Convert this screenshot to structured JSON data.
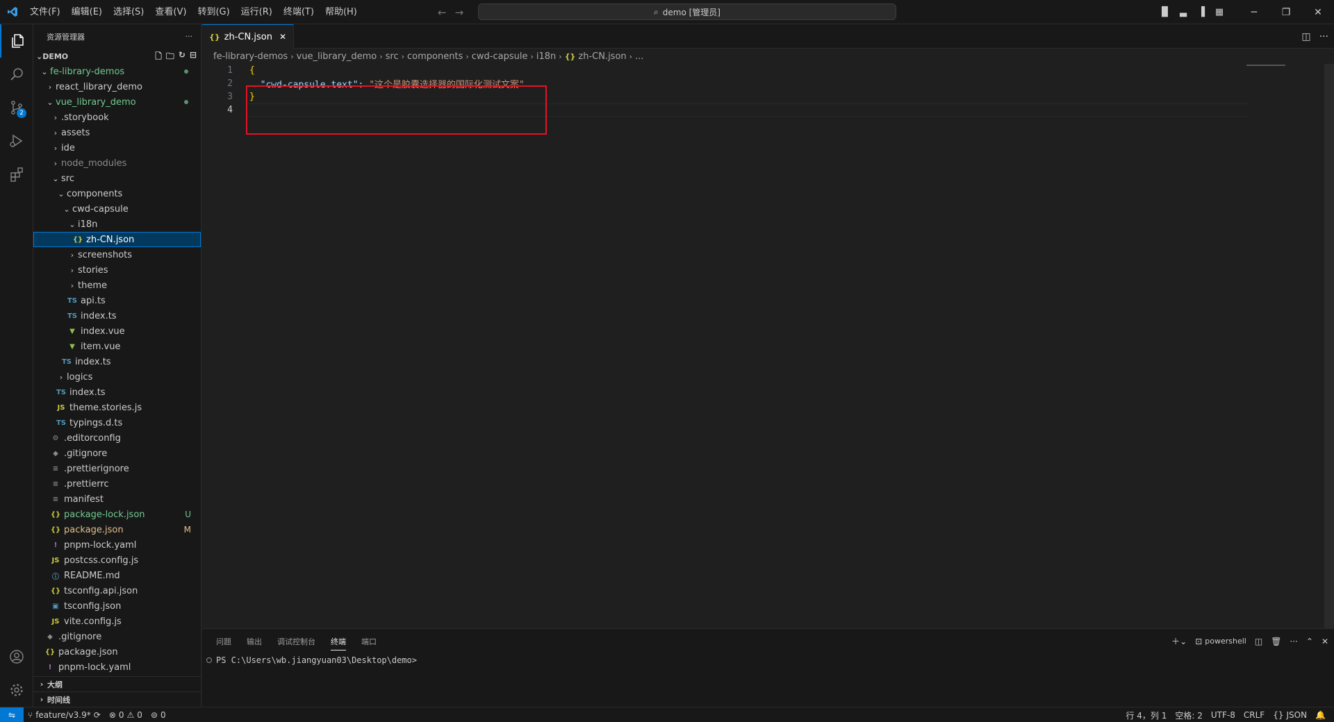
{
  "titlebar": {
    "menu": [
      "文件(F)",
      "编辑(E)",
      "选择(S)",
      "查看(V)",
      "转到(G)",
      "运行(R)",
      "终端(T)",
      "帮助(H)"
    ],
    "search": "demo [管理员]"
  },
  "activitybar": {
    "scm_badge": "2"
  },
  "sidebar": {
    "title": "资源管理器",
    "root": "DEMO",
    "items": [
      {
        "label": "fe-library-demos",
        "indent": 1,
        "type": "folder-open",
        "status": "dot"
      },
      {
        "label": "react_library_demo",
        "indent": 2,
        "type": "folder"
      },
      {
        "label": "vue_library_demo",
        "indent": 2,
        "type": "folder-open",
        "status": "dot"
      },
      {
        "label": ".storybook",
        "indent": 3,
        "type": "folder"
      },
      {
        "label": "assets",
        "indent": 3,
        "type": "folder"
      },
      {
        "label": "ide",
        "indent": 3,
        "type": "folder"
      },
      {
        "label": "node_modules",
        "indent": 3,
        "type": "folder",
        "dim": true
      },
      {
        "label": "src",
        "indent": 3,
        "type": "folder-open"
      },
      {
        "label": "components",
        "indent": 4,
        "type": "folder-open"
      },
      {
        "label": "cwd-capsule",
        "indent": 5,
        "type": "folder-open"
      },
      {
        "label": "i18n",
        "indent": 6,
        "type": "folder-open"
      },
      {
        "label": "zh-CN.json",
        "indent": 7,
        "type": "json",
        "selected": true
      },
      {
        "label": "screenshots",
        "indent": 6,
        "type": "folder"
      },
      {
        "label": "stories",
        "indent": 6,
        "type": "folder"
      },
      {
        "label": "theme",
        "indent": 6,
        "type": "folder"
      },
      {
        "label": "api.ts",
        "indent": 6,
        "type": "ts"
      },
      {
        "label": "index.ts",
        "indent": 6,
        "type": "ts"
      },
      {
        "label": "index.vue",
        "indent": 6,
        "type": "vue"
      },
      {
        "label": "item.vue",
        "indent": 6,
        "type": "vue"
      },
      {
        "label": "index.ts",
        "indent": 5,
        "type": "ts"
      },
      {
        "label": "logics",
        "indent": 4,
        "type": "folder"
      },
      {
        "label": "index.ts",
        "indent": 4,
        "type": "ts"
      },
      {
        "label": "theme.stories.js",
        "indent": 4,
        "type": "js"
      },
      {
        "label": "typings.d.ts",
        "indent": 4,
        "type": "ts"
      },
      {
        "label": ".editorconfig",
        "indent": 3,
        "type": "gear"
      },
      {
        "label": ".gitignore",
        "indent": 3,
        "type": "git"
      },
      {
        "label": ".prettierignore",
        "indent": 3,
        "type": "lines"
      },
      {
        "label": ".prettierrc",
        "indent": 3,
        "type": "lines"
      },
      {
        "label": "manifest",
        "indent": 3,
        "type": "lines"
      },
      {
        "label": "package-lock.json",
        "indent": 3,
        "type": "json",
        "status": "U"
      },
      {
        "label": "package.json",
        "indent": 3,
        "type": "json",
        "status": "M"
      },
      {
        "label": "pnpm-lock.yaml",
        "indent": 3,
        "type": "yaml"
      },
      {
        "label": "postcss.config.js",
        "indent": 3,
        "type": "js"
      },
      {
        "label": "README.md",
        "indent": 3,
        "type": "info"
      },
      {
        "label": "tsconfig.api.json",
        "indent": 3,
        "type": "json"
      },
      {
        "label": "tsconfig.json",
        "indent": 3,
        "type": "tsconfig"
      },
      {
        "label": "vite.config.js",
        "indent": 3,
        "type": "js"
      },
      {
        "label": ".gitignore",
        "indent": 2,
        "type": "git"
      },
      {
        "label": "package.json",
        "indent": 2,
        "type": "json"
      },
      {
        "label": "pnpm-lock.yaml",
        "indent": 2,
        "type": "yaml"
      }
    ],
    "outline": "大纲",
    "timeline": "时间线"
  },
  "editor": {
    "tab": "zh-CN.json",
    "breadcrumb": [
      "fe-library-demos",
      "vue_library_demo",
      "src",
      "components",
      "cwd-capsule",
      "i18n",
      "zh-CN.json",
      "..."
    ],
    "lines": [
      "1",
      "2",
      "3",
      "4"
    ],
    "code": {
      "open": "{",
      "key": "\"cwd-capsule.text\"",
      "colon": ": ",
      "value": "\"这个是胶囊选择器的国际化测试文案\"",
      "close": "}"
    }
  },
  "panel": {
    "tabs": [
      "问题",
      "输出",
      "调试控制台",
      "终端",
      "端口"
    ],
    "active_tab": "终端",
    "shell": "powershell",
    "prompt": "PS C:\\Users\\wb.jiangyuan03\\Desktop\\demo>"
  },
  "statusbar": {
    "branch": "feature/v3.9*",
    "errors": "0",
    "warnings": "0",
    "ports": "0",
    "position": "行 4，列 1",
    "spaces": "空格: 2",
    "encoding": "UTF-8",
    "eol": "CRLF",
    "language": "JSON"
  },
  "colors": {
    "accent": "#0078d4",
    "highlight_box": "#e81123"
  }
}
